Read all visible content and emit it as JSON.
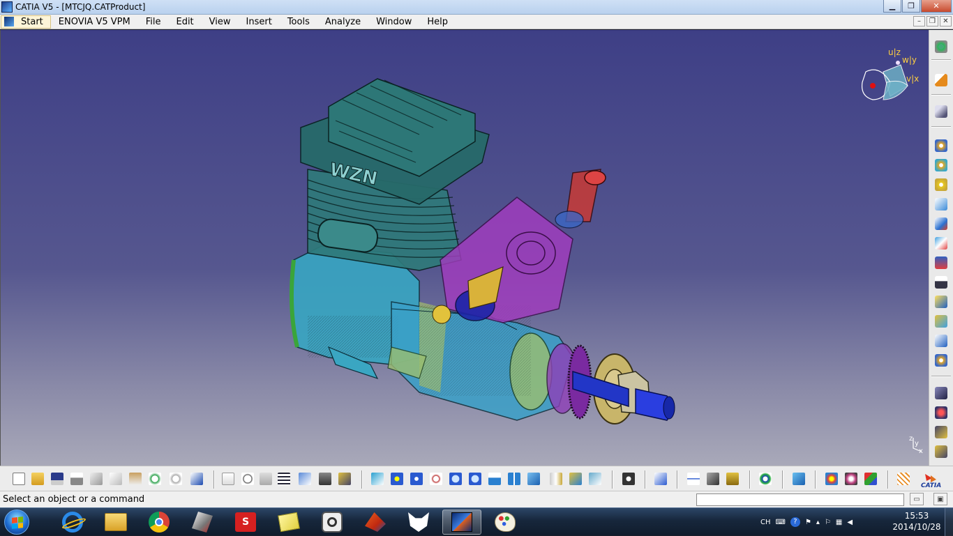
{
  "window": {
    "title": "CATIA V5 - [MTCJQ.CATProduct]",
    "minimize": "▁",
    "restore": "❐",
    "close": "✕"
  },
  "menubar": {
    "start": "Start",
    "items": [
      {
        "label": "ENOVIA V5 VPM"
      },
      {
        "label": "File"
      },
      {
        "label": "Edit"
      },
      {
        "label": "View"
      },
      {
        "label": "Insert"
      },
      {
        "label": "Tools"
      },
      {
        "label": "Analyze"
      },
      {
        "label": "Window"
      },
      {
        "label": "Help"
      }
    ],
    "mdi_minimize": "–",
    "mdi_restore": "❐",
    "mdi_close": "✕"
  },
  "viewport": {
    "engine_logo_text": "WZN",
    "compass_labels": {
      "u_z": "u|z",
      "w_y": "w|y",
      "v_x": "v|x"
    },
    "axis_labels": {
      "z": "z",
      "y": "y",
      "x": "x"
    },
    "colors": {
      "background_top": "#3e3f86",
      "background_bottom": "#a9a9b9",
      "cylinder": "#2f7a7a",
      "crankcase": "#38a6c2",
      "carburetor": "#a23cbf",
      "needle_valve": "#c93a35",
      "shaft": "#2236c7",
      "washer": "#c8b56a"
    }
  },
  "right_toolbar": {
    "icons": [
      "gears-icon",
      "select-arrow-icon",
      "fly-through-icon",
      "assembly-gear-icon",
      "component-gear-icon",
      "part-gear-icon",
      "insert-existing-icon",
      "replace-component-icon",
      "move-icon",
      "snap-icon",
      "reorder-icon",
      "annotation-icon",
      "publish-icon",
      "catalog-icon",
      "numbering-icon",
      "constraint-icon",
      "fix-icon",
      "offset-icon",
      "angle-icon"
    ]
  },
  "bottom_toolbar": {
    "icons": [
      "new-icon",
      "open-icon",
      "save-icon",
      "print-icon",
      "cut-icon",
      "copy-icon",
      "paste-icon",
      "undo-icon",
      "redo-icon",
      "whats-this-icon",
      "formula-icon",
      "comment-icon",
      "knowledge-icon",
      "table-icon",
      "tree-icon",
      "lock-icon",
      "publication-icon",
      "fly-mode-icon",
      "fit-all-icon",
      "pan-icon",
      "rotate-icon",
      "zoom-in-icon",
      "zoom-out-icon",
      "normal-view-icon",
      "multi-view-icon",
      "isometric-view-icon",
      "hide-show-icon",
      "swap-visible-icon",
      "shading-icon",
      "capture-icon",
      "sectioning-icon",
      "measure-icon",
      "clash-icon",
      "space-analysis-icon",
      "catia-spiral-icon",
      "sheet-icon",
      "render-icon",
      "material-icon",
      "color-icon",
      "grid-icon"
    ]
  },
  "status": {
    "message": "Select an object or a command",
    "command_placeholder": ""
  },
  "taskbar": {
    "apps": [
      "internet-explorer-icon",
      "file-explorer-icon",
      "chrome-icon",
      "3dexperience-icon",
      "solidworks-icon",
      "sticky-notes-icon",
      "acrobat-icon",
      "matlab-icon",
      "foxmail-icon",
      "catia-icon",
      "paint-icon"
    ],
    "tray_lang": "CH",
    "clock_time": "15:53",
    "clock_date": "2014/10/28"
  },
  "branding": {
    "catia_label": "CATIA"
  }
}
